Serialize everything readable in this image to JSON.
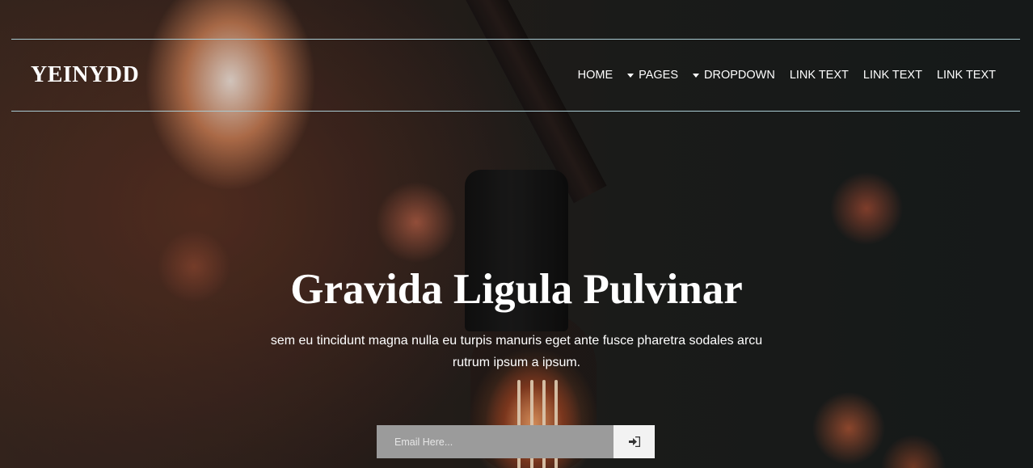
{
  "brand": {
    "name": "YEINYDD"
  },
  "nav": {
    "items": [
      {
        "label": "HOME",
        "dropdown": false
      },
      {
        "label": "PAGES",
        "dropdown": true
      },
      {
        "label": "DROPDOWN",
        "dropdown": true
      },
      {
        "label": "LINK TEXT",
        "dropdown": false
      },
      {
        "label": "LINK TEXT",
        "dropdown": false
      },
      {
        "label": "LINK TEXT",
        "dropdown": false
      }
    ]
  },
  "hero": {
    "title": "Gravida Ligula Pulvinar",
    "subtitle": "sem eu tincidunt magna nulla eu turpis manuris eget ante fusce pharetra sodales arcu rutrum ipsum a ipsum."
  },
  "subscribe": {
    "placeholder": "Email Here...",
    "button_icon": "sign-in-icon"
  },
  "colors": {
    "nav_border": "#a9cbd3",
    "input_bg": "#9b9b9b",
    "button_bg": "#f2f2f2",
    "text": "#ffffff"
  }
}
